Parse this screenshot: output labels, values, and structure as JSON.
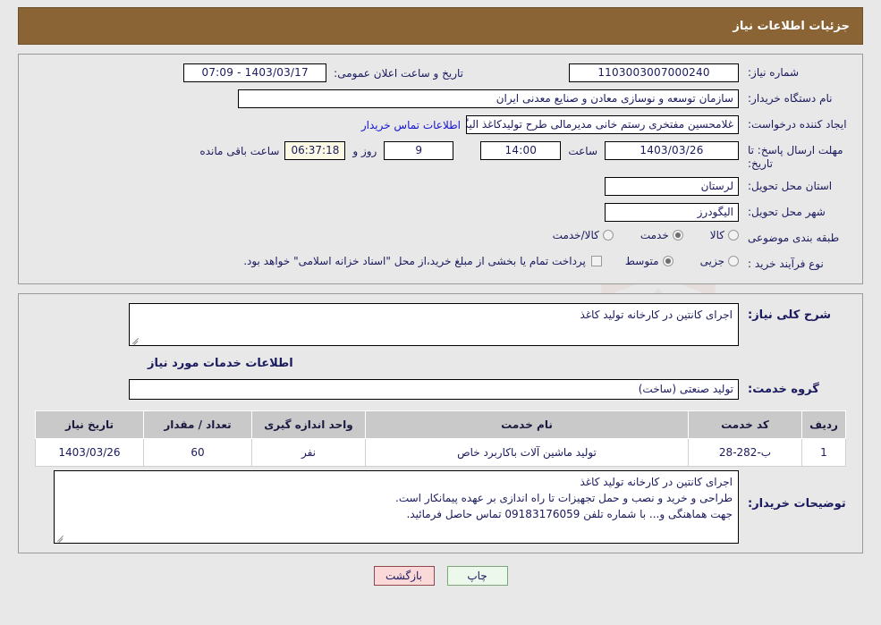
{
  "header": {
    "title": "جزئیات اطلاعات نیاز",
    "bar_color": "#8a6434"
  },
  "watermark": {
    "text": "AriaTender.net"
  },
  "info": {
    "need_number": {
      "label": "شماره نیاز:",
      "value": "1103003007000240"
    },
    "public_announce": {
      "label": "تاریخ و ساعت اعلان عمومی:",
      "value": "1403/03/17 - 07:09"
    },
    "buyer_org": {
      "label": "نام دستگاه خریدار:",
      "value": "سازمان توسعه و نوسازی معادن و صنایع معدنی ایران"
    },
    "request_creator": {
      "label": "ایجاد کننده درخواست:",
      "value": "غلامحسین مفتخری رستم خانی مدیرمالی طرح تولیدکاغذ الیگودرز سازمان توسع",
      "contact_link": "اطلاعات تماس خریدار"
    },
    "deadline": {
      "label": "مهلت ارسال پاسخ: تا تاریخ:",
      "date": "1403/03/26",
      "time_label": "ساعت",
      "time": "14:00",
      "days": "9",
      "days_label": "روز و",
      "countdown": "06:37:18",
      "remaining_label": "ساعت باقی مانده"
    },
    "delivery_province": {
      "label": "استان محل تحویل:",
      "value": "لرستان"
    },
    "delivery_city": {
      "label": "شهر محل تحویل:",
      "value": "الیگودرز"
    },
    "subject_category": {
      "label": "طبقه بندی موضوعی",
      "options": [
        {
          "label": "کالا",
          "selected": false
        },
        {
          "label": "خدمت",
          "selected": true
        },
        {
          "label": "کالا/خدمت",
          "selected": false
        }
      ]
    },
    "purchase_process": {
      "label": "نوع فرآیند خرید :",
      "options": [
        {
          "label": "جزیی",
          "selected": false
        },
        {
          "label": "متوسط",
          "selected": true
        }
      ],
      "treasury_checkbox_checked": false,
      "treasury_note": "پرداخت تمام یا بخشی از مبلغ خرید،از محل \"اسناد خزانه اسلامی\" خواهد بود."
    }
  },
  "details": {
    "general_desc": {
      "label": "شرح کلی نیاز:",
      "value": "اجرای کانتین در کارخانه تولید کاغذ"
    },
    "services_heading": "اطلاعات خدمات مورد نیاز",
    "service_group": {
      "label": "گروه خدمت:",
      "value": "تولید صنعتی (ساخت)"
    },
    "table": {
      "headers": [
        "ردیف",
        "کد خدمت",
        "نام خدمت",
        "واحد اندازه گیری",
        "تعداد / مقدار",
        "تاریخ نیاز"
      ],
      "rows": [
        {
          "radif": "1",
          "code": "ب-282-28",
          "name": "تولید ماشین آلات باکاربرد خاص",
          "unit": "نفر",
          "qty": "60",
          "date": "1403/03/26"
        }
      ]
    },
    "buyer_notes": {
      "label": "توضیحات خریدار:",
      "lines": [
        "اجرای کانتین در کارخانه تولید کاغذ",
        "طراحی و خرید و نصب و حمل تجهیزات تا راه اندازی بر عهده پیمانکار است.",
        "جهت هماهنگی و... با شماره تلفن 09183176059 تماس حاصل فرمائید."
      ]
    }
  },
  "buttons": {
    "print": "چاپ",
    "back": "بازگشت"
  }
}
